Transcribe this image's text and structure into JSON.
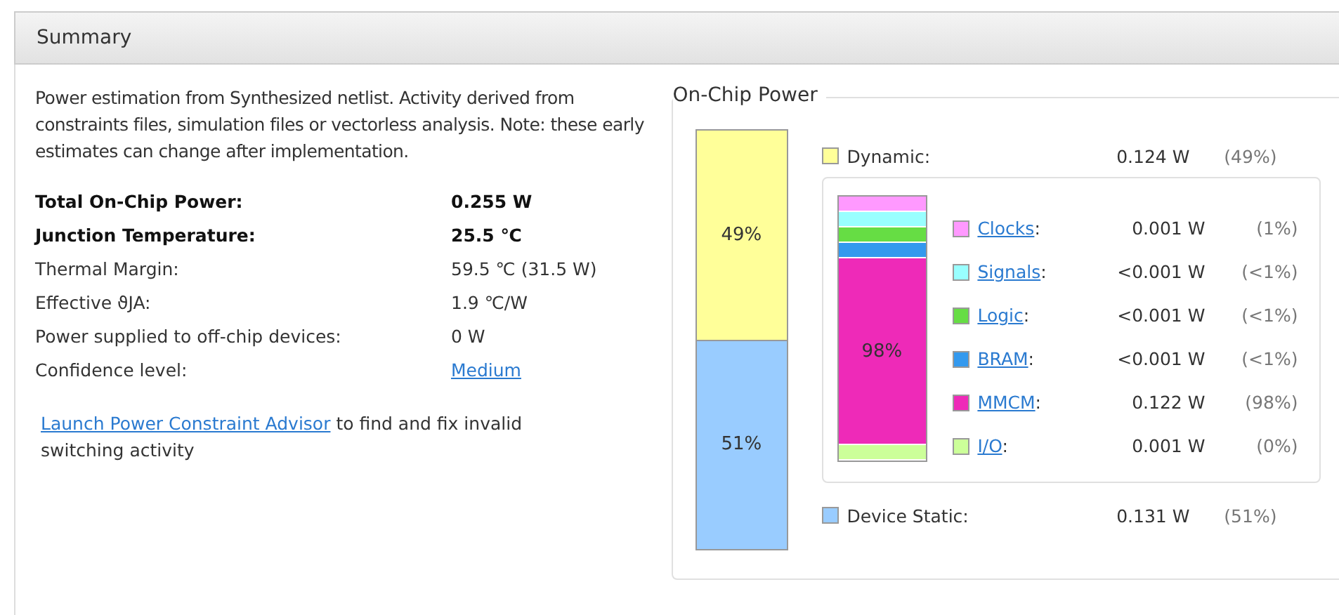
{
  "header": {
    "title": "Summary"
  },
  "description": "Power estimation from Synthesized netlist. Activity derived from constraints files, simulation files or vectorless analysis. Note: these early estimates can change after implementation.",
  "metrics": [
    {
      "label": "Total On-Chip Power:",
      "value": "0.255 W",
      "bold": true,
      "link": false
    },
    {
      "label": "Junction Temperature:",
      "value": "25.5 ℃",
      "bold": true,
      "link": false
    },
    {
      "label": "Thermal Margin:",
      "value": "59.5 ℃ (31.5 W)",
      "bold": false,
      "link": false
    },
    {
      "label": "Effective ϑJA:",
      "value": "1.9 ℃/W",
      "bold": false,
      "link": false
    },
    {
      "label": "Power supplied to off-chip devices:",
      "value": "0 W",
      "bold": false,
      "link": false
    },
    {
      "label": "Confidence level:",
      "value": "Medium",
      "bold": false,
      "link": true
    }
  ],
  "advisor": {
    "link": "Launch Power Constraint Advisor",
    "text": " to find and fix invalid switching activity"
  },
  "on_chip_power": {
    "title": "On-Chip Power",
    "dynamic": {
      "label": "Dynamic:",
      "value": "0.124 W",
      "percent": "(49%)",
      "color": "#ffff99",
      "bar_label": "49%"
    },
    "components": [
      {
        "label": "Clocks",
        "suffix": ":",
        "value": "0.001 W",
        "percent": "(1%)",
        "color": "#ff99ff"
      },
      {
        "label": "Signals",
        "suffix": ":",
        "value": "<0.001 W",
        "percent": "(<1%)",
        "color": "#99ffff"
      },
      {
        "label": "Logic",
        "suffix": ":",
        "value": "<0.001 W",
        "percent": "(<1%)",
        "color": "#66dd44"
      },
      {
        "label": "BRAM",
        "suffix": ":",
        "value": "<0.001 W",
        "percent": "(<1%)",
        "color": "#3399ee"
      },
      {
        "label": "MMCM",
        "suffix": ":",
        "value": "0.122 W",
        "percent": "(98%)",
        "color": "#ee2ab8",
        "bar_label": "98%"
      },
      {
        "label": "I/O",
        "suffix": ":",
        "value": "0.001 W",
        "percent": "(0%)",
        "color": "#ccff99"
      }
    ],
    "static": {
      "label": "Device Static:",
      "value": "0.131 W",
      "percent": "(51%)",
      "color": "#99ccff",
      "bar_label": "51%"
    }
  }
}
